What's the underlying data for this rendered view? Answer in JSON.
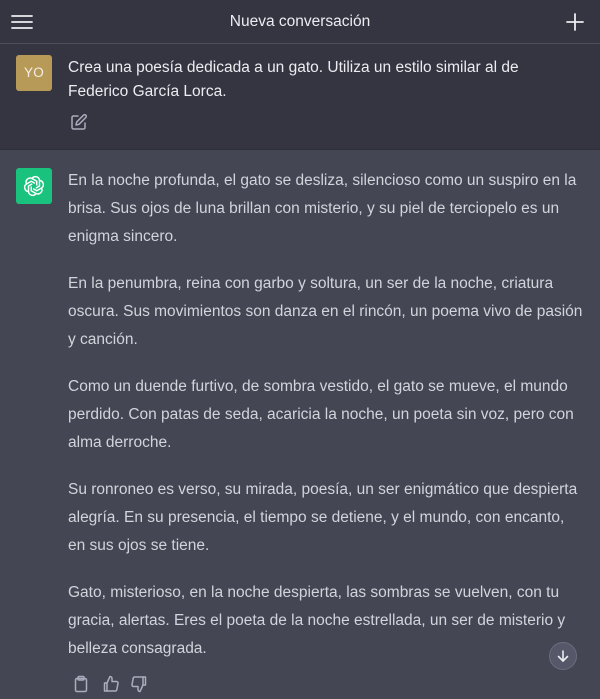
{
  "header": {
    "title": "Nueva conversación",
    "menu_icon": "hamburger-menu-icon",
    "new_chat_icon": "plus-icon"
  },
  "user_message": {
    "avatar_initials": "YO",
    "avatar_color": "#b79a58",
    "text": "Crea una poesía dedicada a un gato. Utiliza un estilo similar al de Federico García Lorca.",
    "edit_icon": "edit-icon"
  },
  "assistant_message": {
    "avatar_icon": "openai-logo-icon",
    "avatar_color": "#19c37d",
    "paragraphs": [
      "En la noche profunda, el gato se desliza, silencioso como un suspiro en la brisa. Sus ojos de luna brillan con misterio, y su piel de terciopelo es un enigma sincero.",
      "En la penumbra, reina con garbo y soltura, un ser de la noche, criatura oscura. Sus movimientos son danza en el rincón, un poema vivo de pasión y canción.",
      "Como un duende furtivo, de sombra vestido, el gato se mueve, el mundo perdido. Con patas de seda, acaricia la noche, un poeta sin voz, pero con alma derroche.",
      "Su ronroneo es verso, su mirada, poesía, un ser enigmático que despierta alegría. En su presencia, el tiempo se detiene, y el mundo, con encanto, en sus ojos se tiene.",
      "Gato, misterioso, en la noche despierta, las sombras se vuelven, con tu gracia, alertas. Eres el poeta de la noche estrellada, un ser de misterio y belleza consagrada."
    ],
    "actions": [
      "clipboard-icon",
      "thumbs-up-icon",
      "thumbs-down-icon"
    ]
  },
  "scroll_down_icon": "arrow-down-icon",
  "colors": {
    "header_bg": "#343541",
    "assistant_bg": "#444654",
    "text": "#d1d5db"
  }
}
